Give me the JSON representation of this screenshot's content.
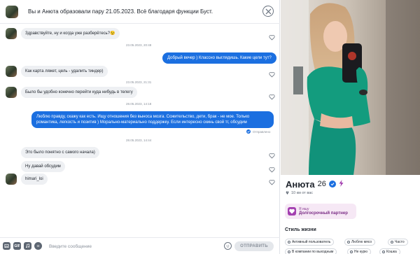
{
  "header": {
    "title": "Вы и Анюта образовали пару 21.05.2023. Всё благодаря функции Буст."
  },
  "messages": [
    {
      "dir": "in",
      "text": "Здравствуйте, ну и когда уже разберётесь?😉",
      "time": "23.05.2023, 20:48"
    },
    {
      "dir": "out",
      "text": "Добрый вечер ) Классно выглядишь. Какие цели тут?"
    },
    {
      "dir": "in",
      "text": "Как карта ляжет, цель - удалить тиндер)",
      "time": "23.05.2023, 21:31"
    },
    {
      "dir": "in",
      "text": "Было бы удобно конечно перейти куда нибудь в телегу",
      "time": "28.05.2023, 14:18"
    },
    {
      "dir": "out",
      "text": "Люблю правду, скажу как есть. Ищу отношения без выноса мозга. Сожительство, дети, брак - не мое. Только романтика, легкость и позитив ) Морально-материально поддержку. Если интересно скинь свой тг, обсудим",
      "status": "Отправлено"
    },
    {
      "dir": "in",
      "text": "Это было понятно с самого начала)",
      "time": "28.05.2023, 14:44"
    },
    {
      "dir": "in",
      "text": "Ну давай обсудим"
    },
    {
      "dir": "in",
      "text": "himari_loi"
    }
  ],
  "composer": {
    "placeholder": "Введите сообщение",
    "send_label": "ОТПРАВИТЬ",
    "gif_label": "GIF"
  },
  "profile": {
    "name": "Анюта",
    "age": "26",
    "distance": "10 км от вас",
    "goal_small": "Я ищу",
    "goal_main": "Долгосрочный партнер",
    "lifestyle_title": "Стиль жизни",
    "chips": [
      "Активный пользователь",
      "Люблю мясо",
      "Часто",
      "В компании по выходным",
      "Не курю",
      "Кошка"
    ]
  },
  "colors": {
    "accent": "#1b6fe0",
    "incoming_bubble": "#eef0f3",
    "goal_badge": "#f6e8f5",
    "dress": "#139c7e"
  }
}
